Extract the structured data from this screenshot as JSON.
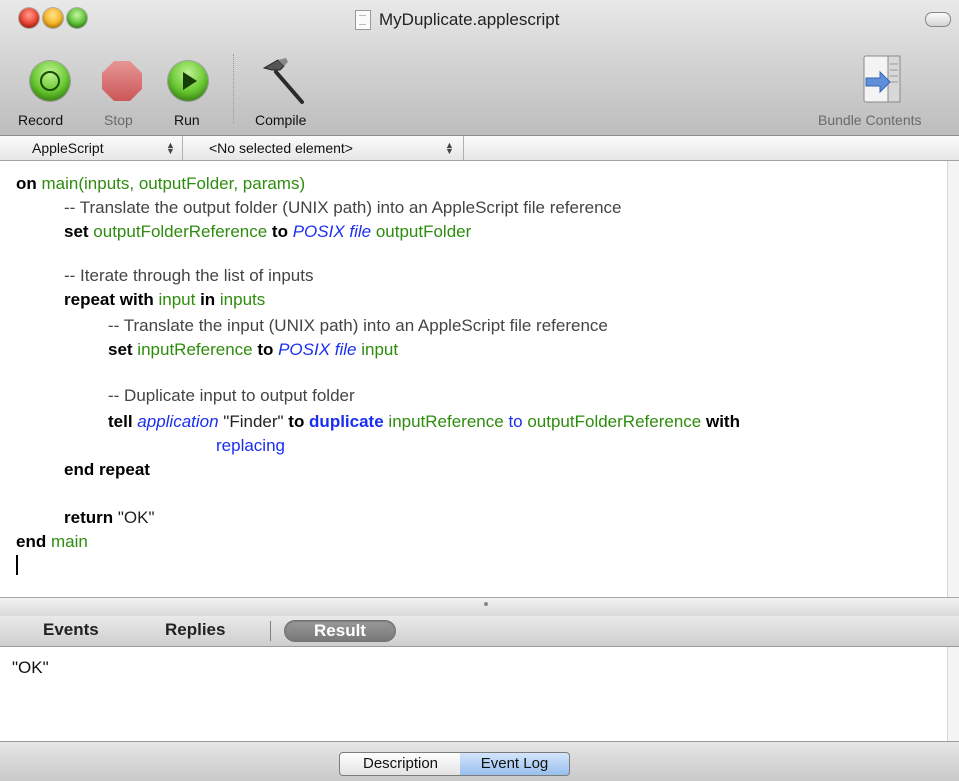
{
  "window": {
    "title": "MyDuplicate.applescript",
    "icons": [
      "close-button",
      "minimize-button",
      "zoom-button",
      "document-icon",
      "toolbar-toggle-button"
    ]
  },
  "toolbar": {
    "record_label": "Record",
    "stop_label": "Stop",
    "run_label": "Run",
    "compile_label": "Compile",
    "bundle_label": "Bundle Contents",
    "icons": [
      "record-icon",
      "stop-icon",
      "run-icon",
      "hammer-icon",
      "bundle-contents-icon"
    ]
  },
  "navbar": {
    "language": "AppleScript",
    "element": "<No selected element>"
  },
  "editor": {
    "lines": [
      {
        "indent": 0,
        "tokens": [
          {
            "t": "on",
            "c": "kw"
          },
          {
            "t": " main(inputs, outputFolder, params)",
            "c": "var"
          }
        ]
      },
      {
        "indent": 1,
        "tokens": [
          {
            "t": "-- Translate the output folder (UNIX path) into an AppleScript file reference",
            "c": "cm"
          }
        ]
      },
      {
        "indent": 1,
        "tokens": [
          {
            "t": "set",
            "c": "kw"
          },
          {
            "t": " outputFolderReference ",
            "c": "var"
          },
          {
            "t": "to",
            "c": "kw"
          },
          {
            "t": " POSIX file",
            "c": "cls"
          },
          {
            "t": " outputFolder",
            "c": "var"
          }
        ]
      },
      {
        "indent": 1,
        "tokens": []
      },
      {
        "indent": 1,
        "tokens": [
          {
            "t": "-- Iterate through the list of inputs",
            "c": "cm"
          }
        ]
      },
      {
        "indent": 1,
        "tokens": [
          {
            "t": "repeat with",
            "c": "kw"
          },
          {
            "t": " input ",
            "c": "var"
          },
          {
            "t": "in",
            "c": "kw"
          },
          {
            "t": " inputs",
            "c": "var"
          }
        ]
      },
      {
        "indent": 2,
        "tokens": [
          {
            "t": "-- Translate the input (UNIX path) into an AppleScript file reference",
            "c": "cm"
          }
        ]
      },
      {
        "indent": 2,
        "tokens": [
          {
            "t": "set",
            "c": "kw"
          },
          {
            "t": " inputReference ",
            "c": "var"
          },
          {
            "t": "to",
            "c": "kw"
          },
          {
            "t": " POSIX file",
            "c": "cls"
          },
          {
            "t": " input",
            "c": "var"
          }
        ]
      },
      {
        "indent": 2,
        "tokens": []
      },
      {
        "indent": 2,
        "tokens": [
          {
            "t": "-- Duplicate input to output folder",
            "c": "cm"
          }
        ]
      },
      {
        "indent": 2,
        "tokens": [
          {
            "t": "tell",
            "c": "kw"
          },
          {
            "t": " application",
            "c": "cls"
          },
          {
            "t": " \"Finder\" ",
            "c": "lit"
          },
          {
            "t": "to",
            "c": "kw"
          },
          {
            "t": " duplicate",
            "c": "kwb"
          },
          {
            "t": " inputReference ",
            "c": "var"
          },
          {
            "t": "to",
            "c": "blu"
          },
          {
            "t": " outputFolderReference ",
            "c": "var"
          },
          {
            "t": "with",
            "c": "kw"
          }
        ]
      },
      {
        "indent": 3,
        "tokens": [
          {
            "t": "replacing",
            "c": "blu"
          }
        ]
      },
      {
        "indent": 1,
        "tokens": [
          {
            "t": "end repeat",
            "c": "kw"
          }
        ]
      },
      {
        "indent": 1,
        "tokens": []
      },
      {
        "indent": 1,
        "tokens": [
          {
            "t": "return",
            "c": "kw"
          },
          {
            "t": " \"OK\"",
            "c": "lit"
          }
        ]
      },
      {
        "indent": 0,
        "tokens": [
          {
            "t": "end",
            "c": "kw"
          },
          {
            "t": " main",
            "c": "var"
          }
        ]
      }
    ]
  },
  "result_tabs": {
    "events": "Events",
    "replies": "Replies",
    "result": "Result"
  },
  "result": {
    "text": "\"OK\""
  },
  "bottom_tabs": {
    "description": "Description",
    "event_log": "Event Log"
  }
}
